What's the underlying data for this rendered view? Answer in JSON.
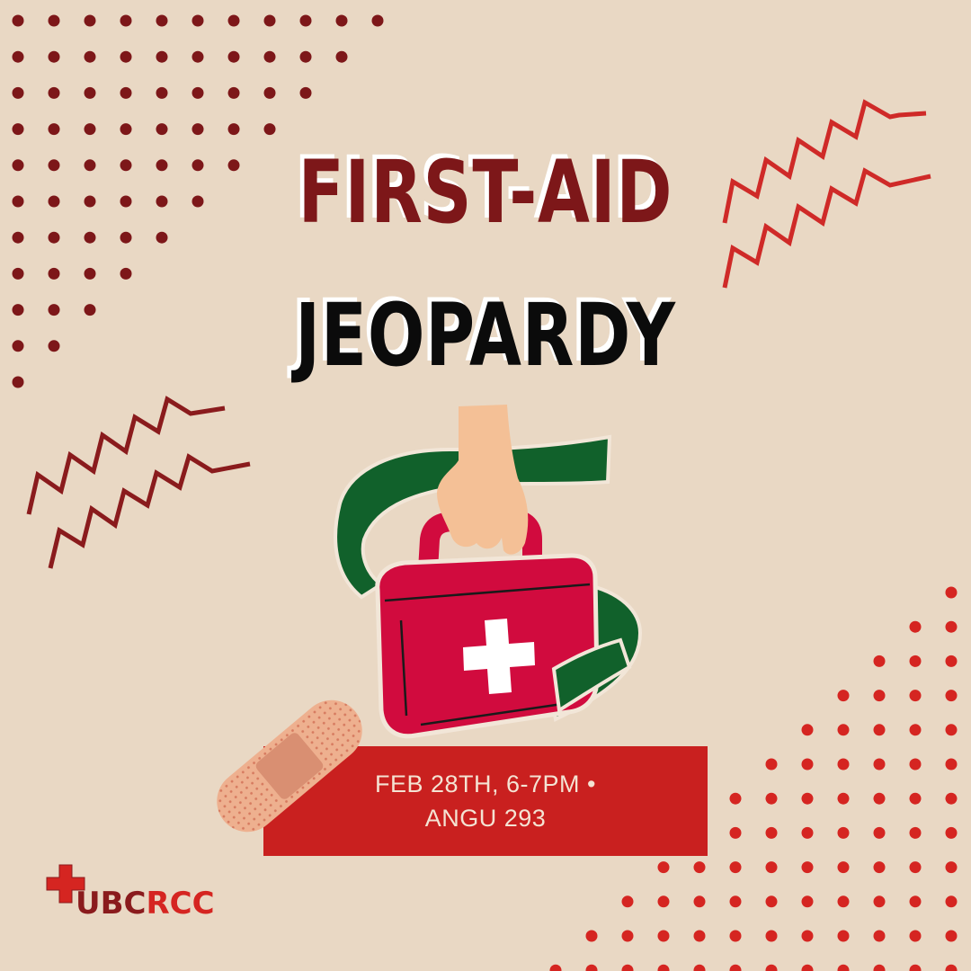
{
  "title": {
    "line1": "FIRST-AID",
    "line2": "JEOPARDY"
  },
  "event": {
    "line1": "FEB 28TH, 6-7PM •",
    "line2": "ANGU 293"
  },
  "logo": {
    "part1": "UBC",
    "part2": "RCC",
    "icon": "red-cross-icon"
  },
  "illustration": {
    "main": "first-aid-kit-with-hand",
    "accent": "adhesive-bandage"
  },
  "colors": {
    "background": "#e9d8c4",
    "dark_red": "#7d1719",
    "red": "#c9201f",
    "bright_red": "#d52521",
    "green": "#11612b",
    "kit_red": "#d10b3e",
    "skin": "#f4c096"
  }
}
